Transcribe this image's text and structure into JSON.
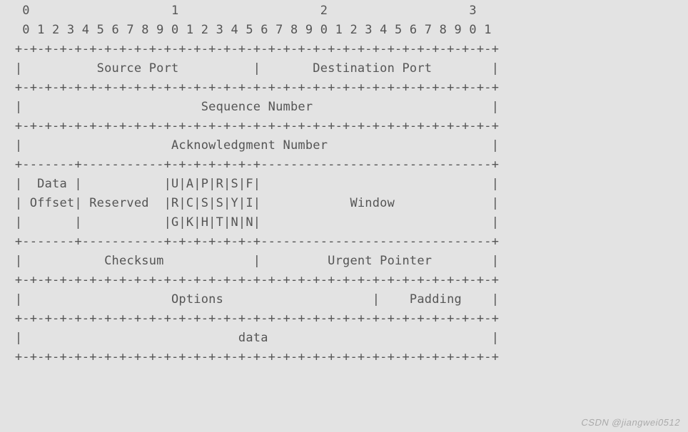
{
  "ruler_major": "   0                   1                   2                   3",
  "ruler_minor": "   0 1 2 3 4 5 6 7 8 9 0 1 2 3 4 5 6 7 8 9 0 1 2 3 4 5 6 7 8 9 0 1",
  "divider_full": "  +-+-+-+-+-+-+-+-+-+-+-+-+-+-+-+-+-+-+-+-+-+-+-+-+-+-+-+-+-+-+-+-+",
  "divider_half": "  +-------+-----------+-+-+-+-+-+-+-------------------------------+",
  "divider_opt": "  +-+-+-+-+-+-+-+-+-+-+-+-+-+-+-+-+-+-+-+-+-+-+-+-+-+-+-+-+-+-+-+-+",
  "row_srcdst": "  |          Source Port          |       Destination Port        |",
  "row_seq": "  |                        Sequence Number                        |",
  "row_ack": "  |                    Acknowledgment Number                      |",
  "row_flags_l1": "  |  Data |           |U|A|P|R|S|F|                               |",
  "row_flags_l2": "  | Offset| Reserved  |R|C|S|S|Y|I|            Window             |",
  "row_flags_l3": "  |       |           |G|K|H|T|N|N|                               |",
  "row_chk_urg": "  |           Checksum            |         Urgent Pointer        |",
  "row_opt_pad": "  |                    Options                    |    Padding    |",
  "row_data": "  |                             data                              |",
  "fields": {
    "source_port": "Source Port",
    "destination_port": "Destination Port",
    "sequence_number": "Sequence Number",
    "acknowledgment_number": "Acknowledgment Number",
    "data_offset": "Data Offset",
    "reserved": "Reserved",
    "flags": [
      "URG",
      "ACK",
      "PSH",
      "RST",
      "SYN",
      "FIN"
    ],
    "window": "Window",
    "checksum": "Checksum",
    "urgent_pointer": "Urgent Pointer",
    "options": "Options",
    "padding": "Padding",
    "data": "data"
  },
  "watermark": "CSDN @jiangwei0512"
}
